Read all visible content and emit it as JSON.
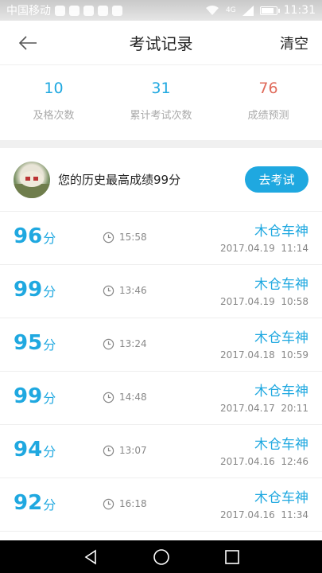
{
  "status_bar": {
    "carrier": "中国移动",
    "network": "4G",
    "time": "11:31",
    "battery_level": 0.75
  },
  "header": {
    "title": "考试记录",
    "clear_label": "清空"
  },
  "stats": [
    {
      "value": "10",
      "label": "及格次数",
      "color": "#1fa8e0"
    },
    {
      "value": "31",
      "label": "累计考试次数",
      "color": "#1fa8e0"
    },
    {
      "value": "76",
      "label": "成绩预测",
      "color": "#e06b5b"
    }
  ],
  "best": {
    "text": "您的历史最高成绩99分",
    "exam_button": "去考试"
  },
  "records": [
    {
      "score": "96",
      "unit": "分",
      "duration": "15:58",
      "name": "木仓车神",
      "date": "2017.04.19",
      "time": "11:14"
    },
    {
      "score": "99",
      "unit": "分",
      "duration": "13:46",
      "name": "木仓车神",
      "date": "2017.04.19",
      "time": "10:58"
    },
    {
      "score": "95",
      "unit": "分",
      "duration": "13:24",
      "name": "木仓车神",
      "date": "2017.04.18",
      "time": "10:59"
    },
    {
      "score": "99",
      "unit": "分",
      "duration": "14:48",
      "name": "木仓车神",
      "date": "2017.04.17",
      "time": "20:11"
    },
    {
      "score": "94",
      "unit": "分",
      "duration": "13:07",
      "name": "木仓车神",
      "date": "2017.04.16",
      "time": "12:46"
    },
    {
      "score": "92",
      "unit": "分",
      "duration": "16:18",
      "name": "木仓车神",
      "date": "2017.04.16",
      "time": "11:34"
    }
  ]
}
